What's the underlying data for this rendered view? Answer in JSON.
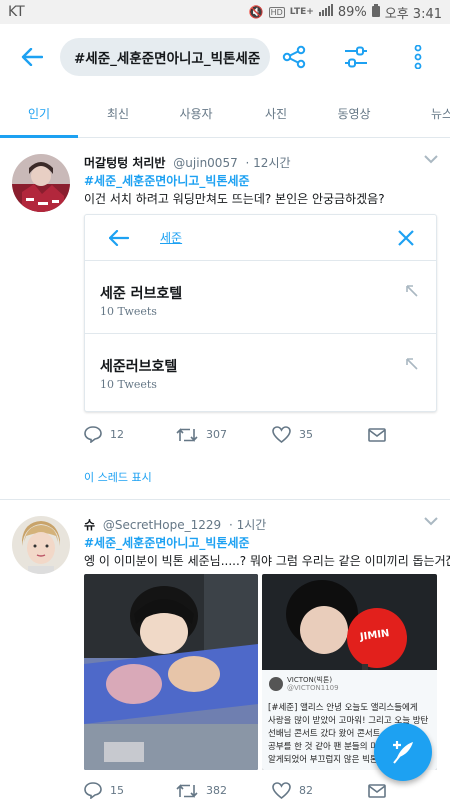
{
  "status": {
    "carrier": "KT",
    "battery": "89%",
    "time": "오후 3:41",
    "network": "LTE+"
  },
  "search": {
    "query": "#세준_세훈준면아니고_빅톤세준"
  },
  "tabs": [
    "인기",
    "최신",
    "사용자",
    "사진",
    "동영상",
    "뉴스"
  ],
  "accent": "#1da1f2",
  "tweets": [
    {
      "name": "머갈텅텅 처리반",
      "handle": "@ujin0057",
      "time": "· 12시간",
      "hashtag": "#세준_세훈준면아니고_빅톤세준",
      "text": "이건 서치 하려고 워딩만쳐도 뜨는데? 본인은 안궁금하겠음?",
      "embed": {
        "query": "세준",
        "suggestions": [
          {
            "title": "세준 러브호텔",
            "sub": "10 Tweets"
          },
          {
            "title": "세준러브호텔",
            "sub": "10 Tweets"
          }
        ]
      },
      "replies": "12",
      "retweets": "307",
      "likes": "35",
      "thread_link": "이 스레드 표시"
    },
    {
      "name": "슈",
      "handle": "@SecretHope_1229",
      "time": "· 1시간",
      "hashtag": "#세준_세훈준면아니고_빅톤세준",
      "text": "엥 이 이미분이 빅톤 세준님.....? 뭐야 그럼 우리는 같은 이미끼리 돕는거잖아",
      "photo_text": {
        "fan": "JIMIN",
        "account": "VICTON(빅톤)",
        "handle": "@VICTON1109",
        "lines": [
          "[#세준] 앨리스 안녕 오늘도 앨리스들에게",
          "사랑을 많이 받았어 고마워! 그리고 오늘 방탄",
          "선배님 콘서트 갔다 왔어 콘서트",
          "공부를 한 것 같아 팬 분들의 미",
          "알게되었어 부끄럽지 않은 빅톤이"
        ]
      },
      "replies": "15",
      "retweets": "382",
      "likes": "82"
    }
  ]
}
